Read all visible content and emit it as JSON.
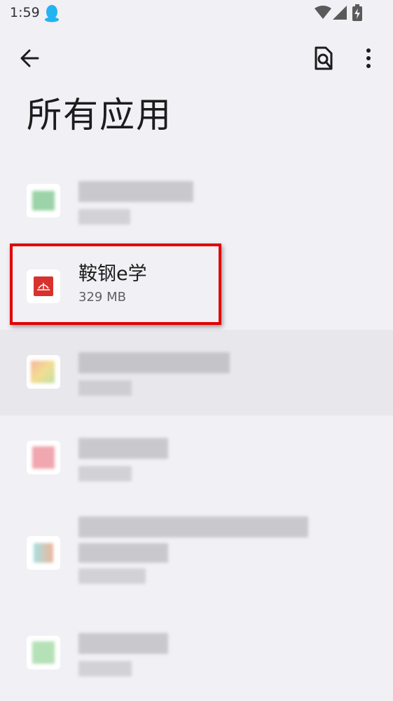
{
  "status_bar": {
    "time": "1:59",
    "icons": [
      "qq-icon",
      "wifi-icon",
      "signal-icon",
      "battery-charging-icon"
    ]
  },
  "toolbar": {
    "back_icon": "arrow-back-icon",
    "search_icon": "search-apps-icon",
    "more_icon": "more-vert-icon"
  },
  "page": {
    "title": "所有应用"
  },
  "apps": [
    {
      "name": "",
      "size": "",
      "blurred": true,
      "icon_color": "#4caf62"
    },
    {
      "name": "鞍钢e学",
      "size": "329 MB",
      "blurred": false,
      "icon_color": "#d8322e"
    },
    {
      "name": "",
      "size": "",
      "blurred": true,
      "icon_color": "#e9c23a"
    },
    {
      "name": "",
      "size": "",
      "blurred": true,
      "icon_color": "#e5606e"
    },
    {
      "name": "",
      "size": "",
      "blurred": true,
      "icon_color": "#5fc6c6"
    },
    {
      "name": "",
      "size": "",
      "blurred": true,
      "icon_color": "#79c97d"
    }
  ],
  "colors": {
    "highlight_frame": "#e00000",
    "background": "#f1f0f5"
  }
}
